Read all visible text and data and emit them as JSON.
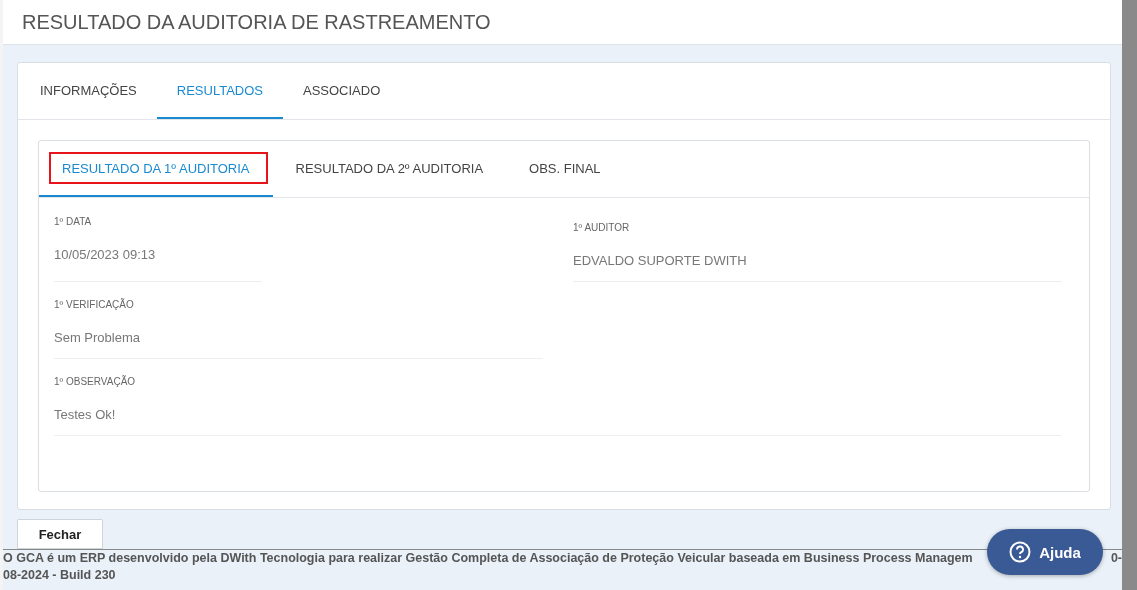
{
  "window": {
    "title": "RESULTADO DA AUDITORIA DE RASTREAMENTO"
  },
  "tabs": [
    {
      "label": "INFORMAÇÕES",
      "selected": false
    },
    {
      "label": "RESULTADOS",
      "selected": true
    },
    {
      "label": "ASSOCIADO",
      "selected": false
    }
  ],
  "subtabs": [
    {
      "label": "RESULTADO DA 1º AUDITORIA",
      "selected": true,
      "outlined": true
    },
    {
      "label": "RESULTADO DA 2º AUDITORIA",
      "selected": false,
      "outlined": false
    },
    {
      "label": "OBS. FINAL",
      "selected": false,
      "outlined": false
    }
  ],
  "fields": [
    {
      "label": "1º DATA",
      "value": "10/05/2023 09:13",
      "kind": "short"
    },
    {
      "label": "1º AUDITOR",
      "value": "EDVALDO SUPORTE DWITH",
      "kind": "right"
    },
    {
      "label": "1º VERIFICAÇÃO",
      "value": "Sem Problema",
      "kind": "half"
    },
    {
      "label": "1º OBSERVAÇÃO",
      "value": "Testes Ok!",
      "kind": "full"
    }
  ],
  "close_button": "Fechar",
  "footer": {
    "line1": "O GCA é um ERP desenvolvido pela DWith Tecnologia para realizar Gestão Completa de Associação de Proteção Veicular baseada em Business Process Managem",
    "line1_tail": "0-",
    "line2": "08-2024 - Build 230"
  },
  "help_button": "Ajuda"
}
